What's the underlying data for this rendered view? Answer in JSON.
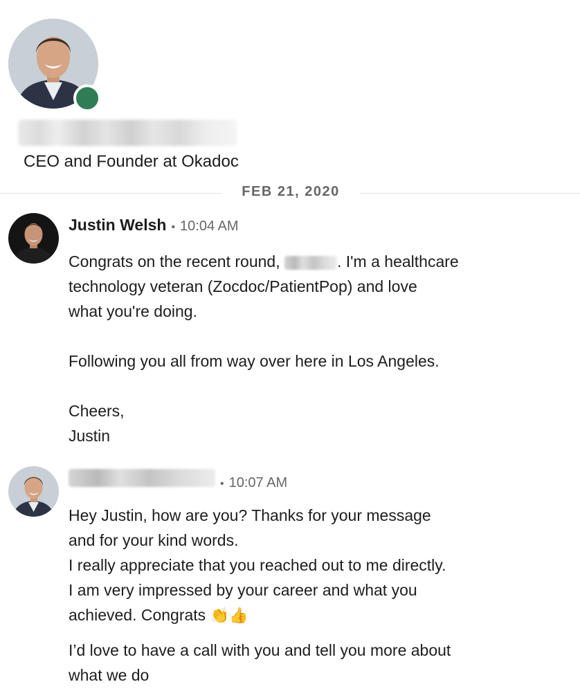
{
  "profile": {
    "headline": "CEO and Founder at Okadoc",
    "status": "online",
    "status_color": "#2f7d55"
  },
  "date_divider": "FEB 21, 2020",
  "messages": [
    {
      "sender": "Justin Welsh",
      "separator": "•",
      "time": "10:04 AM",
      "line1_before": "Congrats on the recent round, ",
      "line1_after": ". I'm a healthcare",
      "line2": "technology veteran (Zocdoc/PatientPop) and love",
      "line3": "what you're doing.",
      "para2": "Following you all from way over here in Los Angeles.",
      "sign1": "Cheers,",
      "sign2": "Justin"
    },
    {
      "separator": "•",
      "time": "10:07 AM",
      "line1": "Hey Justin, how are you? Thanks for your message",
      "line2": "and for your kind words.",
      "line3": "I really appreciate that you reached out to me directly.",
      "line4": "I am very impressed by your career and what you",
      "line5": "achieved. Congrats ",
      "emoji1": "👏",
      "emoji2": "👍",
      "para2_line1": "I’d love to have a call with you and tell you more about",
      "para2_line2": "what we do"
    }
  ]
}
